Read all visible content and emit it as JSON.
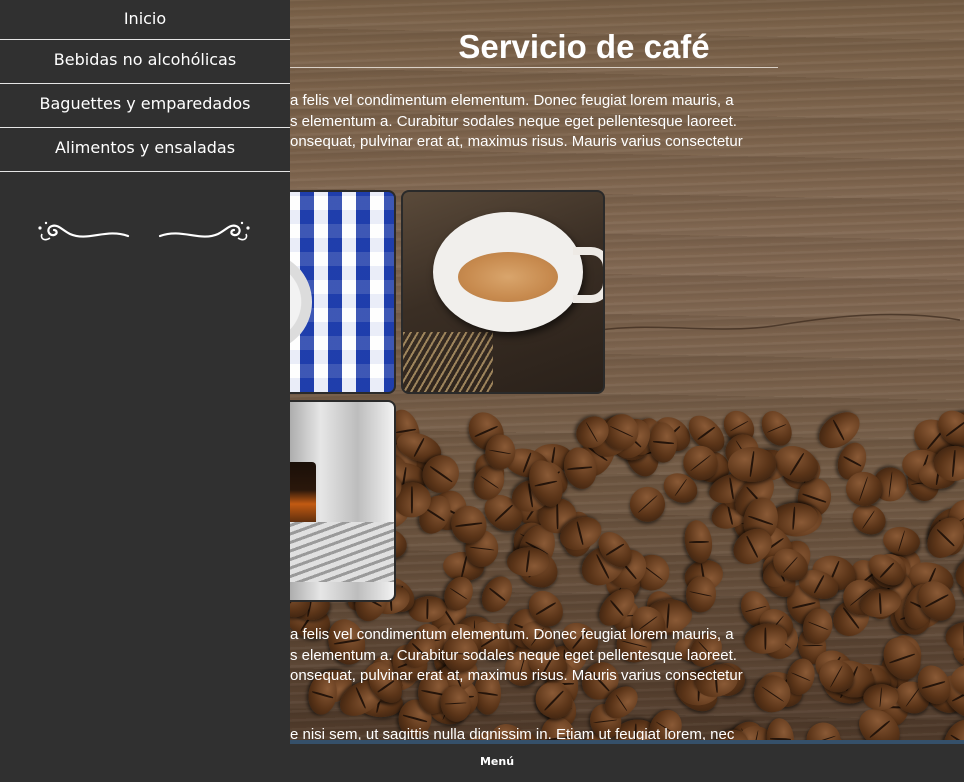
{
  "sidebar": {
    "items": [
      {
        "label": "Inicio"
      },
      {
        "label": "Bebidas no alcohólicas"
      },
      {
        "label": "Baguettes y emparedados"
      },
      {
        "label": "Alimentos y ensaladas"
      }
    ]
  },
  "main": {
    "title": "Servicio de café",
    "paragraph1": [
      "a felis vel condimentum elementum. Donec feugiat lorem mauris, a",
      "s elementum a. Curabitur sodales neque eget pellentesque laoreet.",
      "onsequat, pulvinar erat at, maximus risus. Mauris varius consectetur"
    ],
    "paragraph2": [
      "a felis vel condimentum elementum. Donec feugiat lorem mauris, a",
      "s elementum a. Curabitur sodales neque eget pellentesque laoreet.",
      "onsequat, pulvinar erat at, maximus risus. Mauris varius consectetur"
    ],
    "paragraph3": "e nisi sem, ut sagittis nulla dignissim in. Etiam ut feugiat lorem, nec"
  },
  "bottom_bar": {
    "menu_label": "Menú"
  },
  "colors": {
    "sidebar_bg": "#303030",
    "divider": "#e5e5e5",
    "accent_stripe": "#35506a",
    "text": "#ffffff"
  }
}
